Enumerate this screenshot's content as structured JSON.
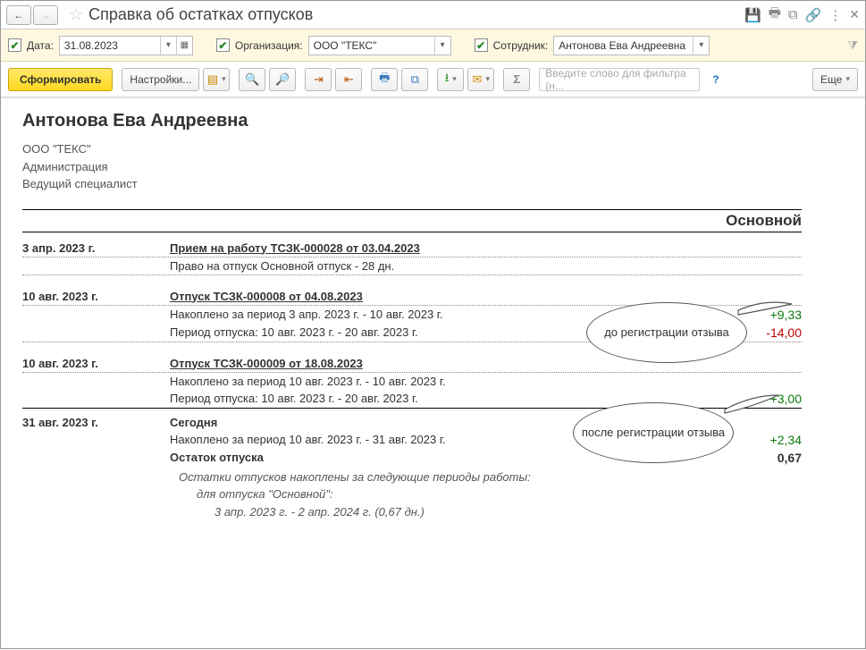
{
  "title": "Справка об остатках отпусков",
  "filter": {
    "date_label": "Дата:",
    "date_value": "31.08.2023",
    "org_label": "Организация:",
    "org_value": "ООО \"ТЕКС\"",
    "emp_label": "Сотрудник:",
    "emp_value": "Антонова Ева Андреевна"
  },
  "toolbar": {
    "form_btn": "Сформировать",
    "settings_btn": "Настройки...",
    "filter_placeholder": "Введите слово для фильтра (н...",
    "more_btn": "Еще"
  },
  "report": {
    "employee": "Антонова Ева Андреевна",
    "org": "ООО \"ТЕКС\"",
    "dept": "Администрация",
    "position": "Ведущий специалист",
    "section_label": "Основной",
    "rows": [
      {
        "date": "3 апр. 2023 г.",
        "title": "Прием на работу ТСЗК-000028 от 03.04.2023",
        "line1": "Право на отпуск Основной отпуск - 28 дн."
      },
      {
        "date": "10 авг. 2023 г.",
        "title": "Отпуск ТСЗК-000008 от 04.08.2023",
        "line1": "Накоплено за период 3 апр. 2023 г. - 10 авг. 2023 г.",
        "line2": "Период отпуска: 10 авг. 2023 г. - 20 авг. 2023 г.",
        "val1": "+9,33",
        "val2": "-14,00"
      },
      {
        "date": "10 авг. 2023 г.",
        "title": "Отпуск ТСЗК-000009 от 18.08.2023",
        "line1": "Накоплено за период 10 авг. 2023 г. - 10 авг. 2023 г.",
        "line2": "Период отпуска: 10 авг. 2023 г. - 20 авг. 2023 г.",
        "val2": "+3,00"
      }
    ],
    "today": {
      "date": "31 авг. 2023 г.",
      "label": "Сегодня",
      "line1": "Накоплено за период 10 авг. 2023 г. - 31 авг. 2023 г.",
      "val1": "+2,34",
      "balance_label": "Остаток отпуска",
      "balance_val": "0,67",
      "footnote_head": "Остатки отпусков накоплены за следующие периоды работы:",
      "footnote_sub": "для отпуска \"Основной\":",
      "footnote_period": "3 апр. 2023 г. - 2 апр. 2024 г. (0,67 дн.)"
    }
  },
  "callouts": {
    "before": "до регистрации отзыва",
    "after": "после регистрации отзыва"
  }
}
